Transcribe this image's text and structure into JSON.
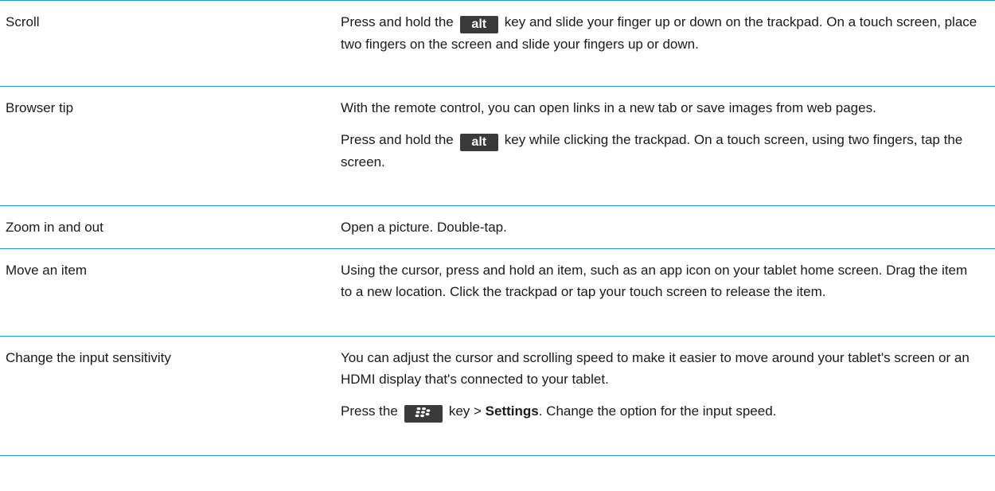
{
  "rows": [
    {
      "action": "Scroll",
      "p1_before": "Press and hold the",
      "p1_key": "alt",
      "p1_after": "key and slide your finger up or down on the trackpad. On a touch screen, place two fingers on the screen and slide your fingers up or down."
    },
    {
      "action": "Browser tip",
      "p1": "With the remote control, you can open links in a new tab or save images from web pages.",
      "p2_before": "Press and hold the",
      "p2_key": "alt",
      "p2_after": "key while clicking the trackpad. On a touch screen, using two fingers, tap the screen."
    },
    {
      "action": "Zoom in and out",
      "p1": "Open a picture. Double-tap."
    },
    {
      "action": "Move an item",
      "p1": "Using the cursor, press and hold an item, such as an app icon on your tablet home screen. Drag the item to a new location. Click the trackpad or tap your touch screen to release the item."
    },
    {
      "action": "Change the input sensitivity",
      "p1": "You can adjust the cursor and scrolling speed to make it easier to move around your tablet's screen or an HDMI display that's connected to your tablet.",
      "p2_before": "Press the",
      "p2_key_icon": "blackberry-menu-key-icon",
      "p2_middle": "key >",
      "p2_bold": "Settings",
      "p2_after": ". Change the option for the input speed."
    }
  ],
  "colors": {
    "rule": "#2196d3",
    "key_bg": "#3a3a3a",
    "key_fg": "#ffffff"
  }
}
